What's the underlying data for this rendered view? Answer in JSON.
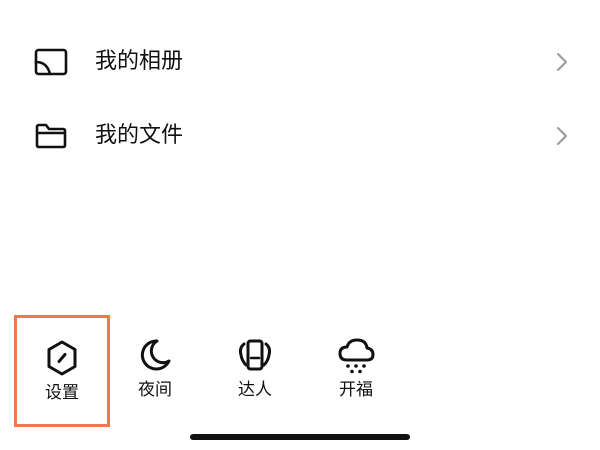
{
  "menu": {
    "items": [
      {
        "label": "我的相册",
        "icon": "photo-album-icon"
      },
      {
        "label": "我的文件",
        "icon": "folder-icon"
      }
    ]
  },
  "toolbar": {
    "items": [
      {
        "label": "设置",
        "icon": "settings-hexagon-icon",
        "highlighted": true
      },
      {
        "label": "夜间",
        "icon": "moon-icon"
      },
      {
        "label": "达人",
        "icon": "expert-badge-icon"
      },
      {
        "label": "开福",
        "icon": "cloud-snow-icon"
      }
    ]
  },
  "colors": {
    "highlight_border": "#f07a45",
    "text": "#111111",
    "chevron": "#9a9a9a",
    "background": "#ffffff",
    "home_indicator": "#111111"
  }
}
